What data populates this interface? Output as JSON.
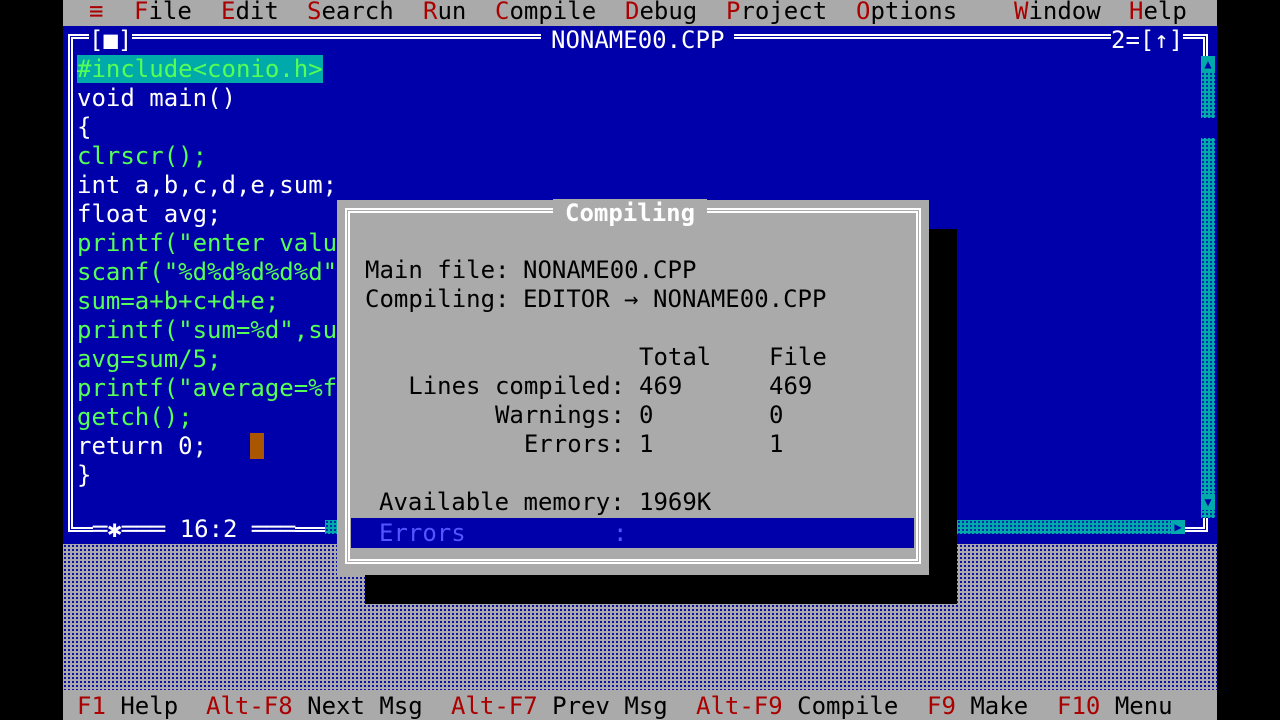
{
  "menu": {
    "system": "≡",
    "items": [
      {
        "hot": "F",
        "rest": "ile"
      },
      {
        "hot": "E",
        "rest": "dit"
      },
      {
        "hot": "S",
        "rest": "earch"
      },
      {
        "hot": "R",
        "rest": "un"
      },
      {
        "hot": "C",
        "rest": "ompile"
      },
      {
        "hot": "D",
        "rest": "ebug"
      },
      {
        "hot": "P",
        "rest": "roject"
      },
      {
        "hot": "O",
        "rest": "ptions"
      },
      {
        "hot": "W",
        "rest": "indow"
      },
      {
        "hot": "H",
        "rest": "elp"
      }
    ]
  },
  "editor": {
    "title": "NONAME00.CPP",
    "close_box": "[■]",
    "window_number": "2=[↑]",
    "cursor_position": "16:2",
    "lines": [
      {
        "text": "#include<conio.h>"
      },
      {
        "text": "void main()"
      },
      {
        "text": "{"
      },
      {
        "text": "clrscr();"
      },
      {
        "text": "int a,b,c,d,e,sum;"
      },
      {
        "text": "float avg;"
      },
      {
        "text": "printf(\"enter valu"
      },
      {
        "text": "scanf(\"%d%d%d%d%d\""
      },
      {
        "text": "sum=a+b+c+d+e;"
      },
      {
        "text": "printf(\"sum=%d\",su"
      },
      {
        "text": "avg=sum/5;"
      },
      {
        "text": "printf(\"average=%f"
      },
      {
        "text": "getch();"
      },
      {
        "text": "return 0;"
      },
      {
        "text": "}"
      }
    ]
  },
  "dialog": {
    "title": "Compiling",
    "main_file_label": "Main file:",
    "main_file_value": "NONAME00.CPP",
    "compiling_label": "Compiling:",
    "compiling_value": "EDITOR → NONAME00.CPP",
    "col_total": "Total",
    "col_file": "File",
    "rows": [
      {
        "label": "Lines compiled:",
        "total": "469",
        "file": "469"
      },
      {
        "label": "Warnings:",
        "total": "0",
        "file": "0"
      },
      {
        "label": "Errors:",
        "total": "1",
        "file": "1"
      }
    ],
    "memory_label": "Available memory:",
    "memory_value": "1969K",
    "status_label": "Errors",
    "status_colon": ":"
  },
  "function_keys": [
    {
      "key": "F1",
      "label": "Help"
    },
    {
      "key": "Alt-F8",
      "label": "Next Msg"
    },
    {
      "key": "Alt-F7",
      "label": "Prev Msg"
    },
    {
      "key": "Alt-F9",
      "label": "Compile"
    },
    {
      "key": "F9",
      "label": "Make"
    },
    {
      "key": "F10",
      "label": "Menu"
    }
  ],
  "colors": {
    "editor_bg": "#0000aa",
    "menu_bg": "#aaaaaa",
    "hotkey": "#aa0000",
    "keyword_green": "#55ff55",
    "string_red": "#aa0000"
  }
}
